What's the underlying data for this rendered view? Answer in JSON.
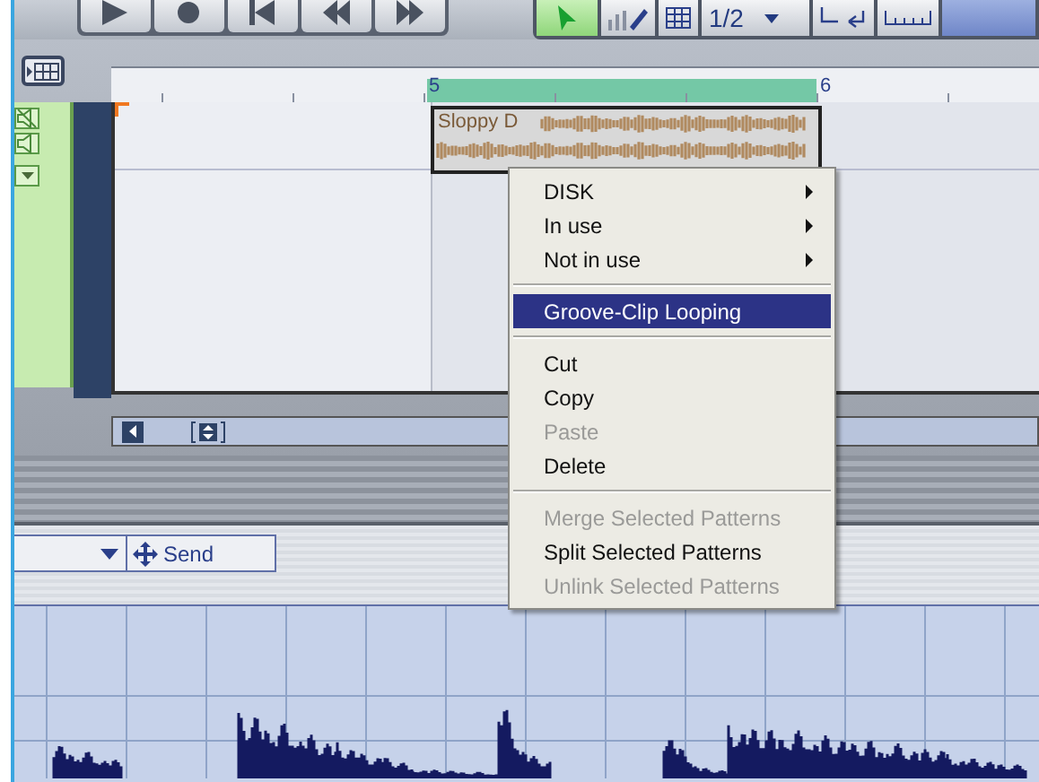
{
  "toolbar": {
    "snap_value": "1/2"
  },
  "ruler": {
    "markers": [
      {
        "label": "5"
      },
      {
        "label": "6"
      }
    ]
  },
  "clip": {
    "name": "Sloppy D",
    "selected": true
  },
  "send_button": {
    "label": "Send"
  },
  "context_menu": {
    "items": [
      {
        "kind": "item",
        "label": "DISK",
        "submenu": true,
        "disabled": false,
        "selected": false
      },
      {
        "kind": "item",
        "label": "In use",
        "submenu": true,
        "disabled": false,
        "selected": false
      },
      {
        "kind": "item",
        "label": "Not in use",
        "submenu": true,
        "disabled": false,
        "selected": false
      },
      {
        "kind": "separator"
      },
      {
        "kind": "item",
        "label": "Groove-Clip Looping",
        "submenu": false,
        "disabled": false,
        "selected": true
      },
      {
        "kind": "separator"
      },
      {
        "kind": "item",
        "label": "Cut",
        "submenu": false,
        "disabled": false,
        "selected": false
      },
      {
        "kind": "item",
        "label": "Copy",
        "submenu": false,
        "disabled": false,
        "selected": false
      },
      {
        "kind": "item",
        "label": "Paste",
        "submenu": false,
        "disabled": true,
        "selected": false
      },
      {
        "kind": "item",
        "label": "Delete",
        "submenu": false,
        "disabled": false,
        "selected": false
      },
      {
        "kind": "separator"
      },
      {
        "kind": "item",
        "label": "Merge Selected Patterns",
        "submenu": false,
        "disabled": true,
        "selected": false
      },
      {
        "kind": "item",
        "label": "Split Selected Patterns",
        "submenu": false,
        "disabled": false,
        "selected": false
      },
      {
        "kind": "item",
        "label": "Unlink Selected Patterns",
        "submenu": false,
        "disabled": true,
        "selected": false
      }
    ]
  }
}
